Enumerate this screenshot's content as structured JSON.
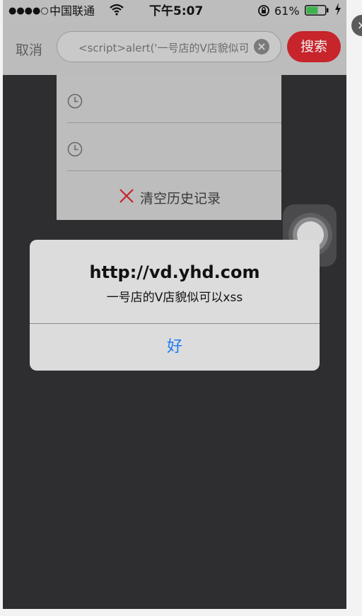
{
  "status_bar": {
    "signal": "●●●●○",
    "carrier": "中国联通",
    "time": "下午5:07",
    "battery_percent": "61%",
    "battery_level": 0.61
  },
  "header": {
    "cancel_label": "取消",
    "search_value": "<script>alert('一号店的V店貌似可以xss",
    "search_button_label": "搜索"
  },
  "history": {
    "items": [
      "",
      ""
    ],
    "clear_label": "清空历史记录"
  },
  "alert": {
    "title": "http://vd.yhd.com",
    "message": "一号店的V店貌似可以xss",
    "ok_label": "好"
  },
  "colors": {
    "accent_red": "#c7242b",
    "link_blue": "#1a7df2"
  }
}
